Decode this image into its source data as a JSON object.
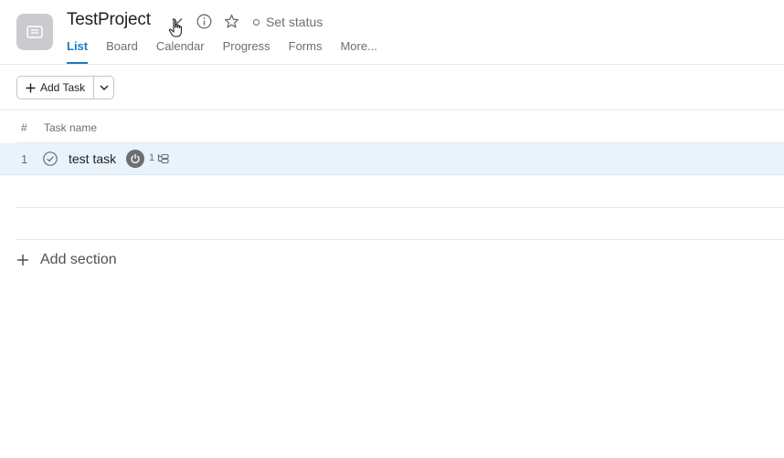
{
  "project": {
    "title": "TestProject",
    "set_status_label": "Set status"
  },
  "tabs": [
    {
      "label": "List",
      "active": true
    },
    {
      "label": "Board",
      "active": false
    },
    {
      "label": "Calendar",
      "active": false
    },
    {
      "label": "Progress",
      "active": false
    },
    {
      "label": "Forms",
      "active": false
    },
    {
      "label": "More..."
    }
  ],
  "toolbar": {
    "add_task_label": "Add Task"
  },
  "table": {
    "columns": [
      "#",
      "Task name"
    ],
    "rows": [
      {
        "number": "1",
        "name": "test task",
        "subtask_count": "1"
      }
    ]
  },
  "add_section_label": "Add section",
  "colors": {
    "accent": "#1a7bbd",
    "row_highlight": "#e8f3fb"
  }
}
